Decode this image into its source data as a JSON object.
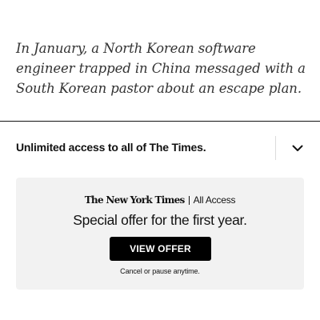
{
  "article": {
    "lede": "In January, a North Korean software engineer trapped in China messaged with a South Korean pastor about an escape plan."
  },
  "subscription_bar": {
    "message": "Unlimited access to all of The Times.",
    "toggle_icon": "chevron-down-icon"
  },
  "offer": {
    "brand_logo": "The New York Times",
    "brand_product": "All Access",
    "headline": "Special offer for the first year.",
    "button_label": "VIEW OFFER",
    "fine_print": "Cancel or pause anytime.",
    "card_color": "#f2f2f2",
    "button_color": "#000000"
  }
}
